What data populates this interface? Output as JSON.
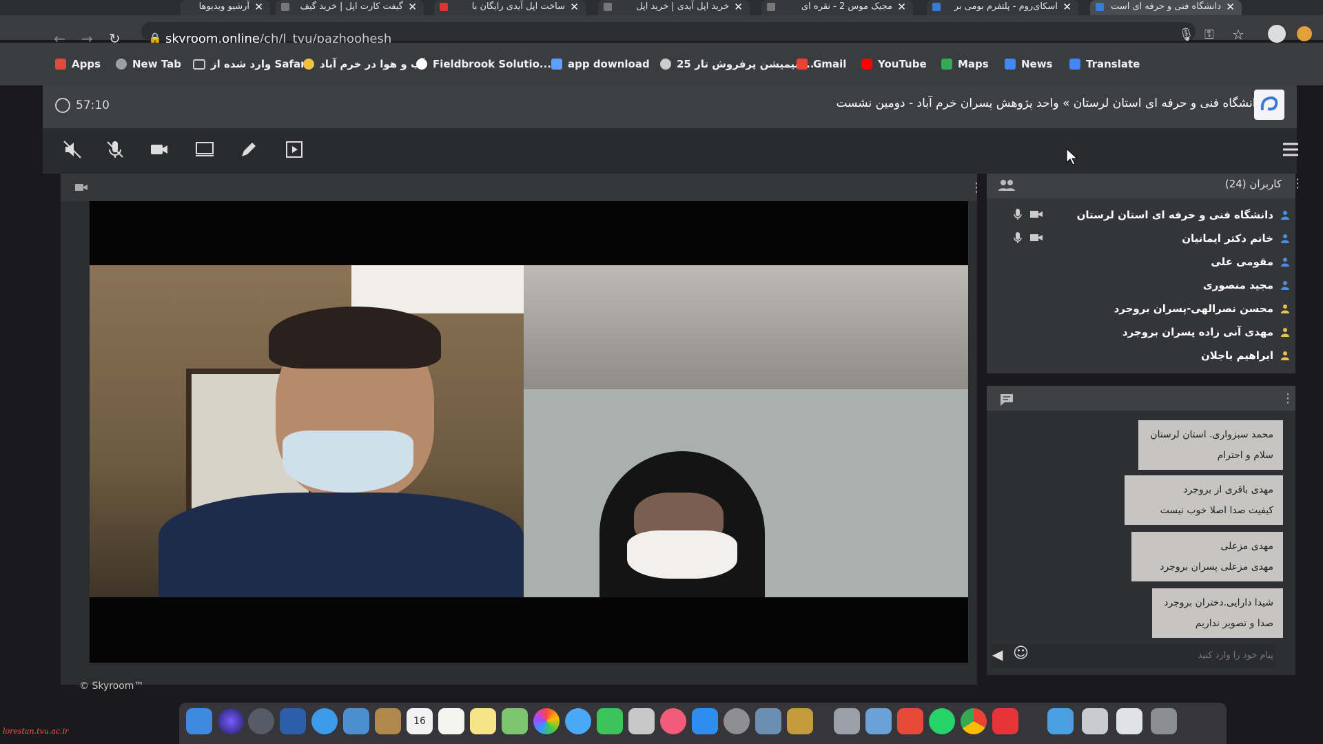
{
  "browser": {
    "tabs": [
      {
        "label": "آرشیو ویدیوها",
        "active": false
      },
      {
        "label": "گیفت کارت اپل | خرید گیف",
        "active": false
      },
      {
        "label": "ساخت اپل آیدی رایگان با",
        "active": false
      },
      {
        "label": "خرید اپل آیدی | خرید اپل",
        "active": false
      },
      {
        "label": "مجیک موس 2 - نقره ای",
        "active": false
      },
      {
        "label": "اسکای‌روم - پلتفرم بومی بر",
        "active": false
      },
      {
        "label": "دانشگاه فنی و حرفه ای است",
        "active": true
      }
    ],
    "close_glyph": "✕",
    "url_host": "skyroom.online",
    "url_path": "/ch/l_tvu/pazhoohesh",
    "bookmarks": [
      {
        "label": "Apps",
        "color": "#e04a3a"
      },
      {
        "label": "New Tab",
        "color": "#9aa0a6"
      },
      {
        "label": "وارد شده از Safari",
        "color": "#c9c9c9"
      },
      {
        "label": "آب و هوا در خرم آباد",
        "color": "#f0c040"
      },
      {
        "label": "Fieldbrook Solutio...",
        "color": "#ffffff"
      },
      {
        "label": "app download",
        "color": "#5aa0ff"
      },
      {
        "label": "25 انیمیشن پرفروش تار...",
        "color": "#cccccc"
      },
      {
        "label": "Gmail",
        "color": "#ea4335"
      },
      {
        "label": "YouTube",
        "color": "#ff0000"
      },
      {
        "label": "Maps",
        "color": "#34a853"
      },
      {
        "label": "News",
        "color": "#4285f4"
      },
      {
        "label": "Translate",
        "color": "#4285f4"
      }
    ]
  },
  "room": {
    "title": "دانشگاه فنی و حرفه ای استان لرستان » واحد پژوهش پسران خرم آباد - دومین نشست",
    "timer": "57:10"
  },
  "users": {
    "title": "کاربران (24)",
    "list": [
      {
        "name": "دانشگاه فنی و حرفه ای استان لرستان",
        "color": "#4a90e2",
        "media": true
      },
      {
        "name": "خانم دکتر ایمانیان",
        "color": "#4a90e2",
        "media": true
      },
      {
        "name": "مقومی علی",
        "color": "#4a90e2",
        "media": false
      },
      {
        "name": "مجید منصوری",
        "color": "#4a90e2",
        "media": false
      },
      {
        "name": "محسن نصرالهی-پسران بروجرد",
        "color": "#e6c24a",
        "media": false
      },
      {
        "name": "مهدی آنی زاده پسران بروجرد",
        "color": "#e6c24a",
        "media": false
      },
      {
        "name": "ابراهیم باجلان",
        "color": "#e6c24a",
        "media": false
      }
    ]
  },
  "chat": {
    "messages": [
      {
        "author": "محمد سبزواری. استان لرستان",
        "text": "سلام و احترام"
      },
      {
        "author": "مهدی باقری از بروجرد",
        "text": "کیفیت صدا اصلا خوب نیست"
      },
      {
        "author": "مهدی مزعلی",
        "text": "مهدی مزعلی پسران بروجرد"
      },
      {
        "author": "شیدا دارایی.دختران بروجرد",
        "text": "صدا و تصویر نداریم"
      }
    ],
    "placeholder": "پیام خود را وارد کنید",
    "send_glyph": "◀",
    "emoji_glyph": "☺"
  },
  "footer": {
    "copyright": "© Skyroom™"
  },
  "watermark": "lorestan.tvu.ac.ir",
  "dock": {
    "calendar_day": "16"
  },
  "toolbar_icons": [
    "speaker-off-icon",
    "mic-off-icon",
    "camera-icon",
    "screen-share-icon",
    "pen-icon",
    "presentation-icon"
  ]
}
